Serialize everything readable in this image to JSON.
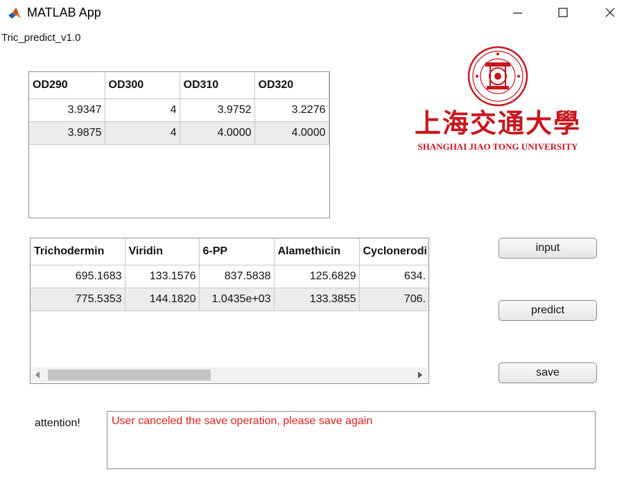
{
  "window": {
    "title": "MATLAB App",
    "controls": {
      "minimize": "–",
      "maximize": "☐",
      "close": "✕"
    }
  },
  "app": {
    "name_label": "Tric_predict_v1.0"
  },
  "od_table": {
    "columns": [
      "OD290",
      "OD300",
      "OD310",
      "OD320"
    ],
    "rows": [
      [
        "3.9347",
        "4",
        "3.9752",
        "3.2276"
      ],
      [
        "3.9875",
        "4",
        "4.0000",
        "4.0000"
      ]
    ]
  },
  "result_table": {
    "columns": [
      "Trichodermin",
      "Viridin",
      "6-PP",
      "Alamethicin",
      "Cyclonerodi"
    ],
    "rows": [
      [
        "695.1683",
        "133.1576",
        "837.5838",
        "125.6829",
        "634."
      ],
      [
        "775.5353",
        "144.1820",
        "1.0435e+03",
        "133.3855",
        "706."
      ]
    ]
  },
  "buttons": {
    "input": "input",
    "predict": "predict",
    "save": "save"
  },
  "attention": {
    "label": "attention!",
    "message": "User canceled the save operation, please save again"
  },
  "logo": {
    "chinese": "上海交通大學",
    "english": "SHANGHAI JIAO TONG UNIVERSITY"
  },
  "colors": {
    "logo_red": "#c8161d",
    "message_red": "#e02020",
    "row_alt": "#ececec"
  }
}
